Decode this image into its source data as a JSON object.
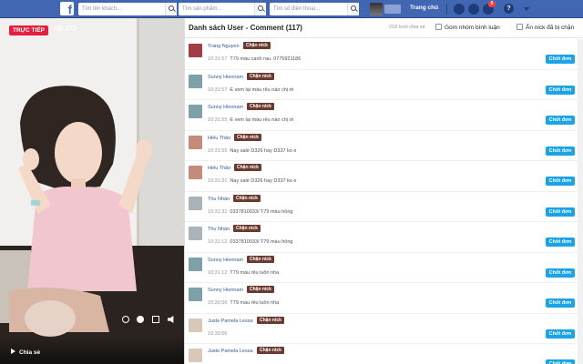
{
  "topbar": {
    "logo": "f",
    "search_name_placeholder": "Tìm tên khách...",
    "search_product_placeholder": "Tìm sản phẩm...",
    "search_phone_placeholder": "Tìm số điện thoại...",
    "home_label": "Trang chủ",
    "notification_count": "5",
    "help_label": "?",
    "colors": {
      "bar": "#4267b2",
      "badge": "#fa3e3e"
    }
  },
  "video": {
    "live_label": "TRỰC TIẾP",
    "viewer_count": "173",
    "share_label": "Chia sẻ"
  },
  "panel": {
    "title": "Danh sách User - Comment (117)",
    "stat": "218 lượt chia sẻ",
    "group_label": "Gom nhóm bình luận",
    "hide_blocked_label": "Ẩn nick đã bị chặn",
    "block_label": "Chặn nick",
    "order_label": "Chốt đơn",
    "comments": [
      {
        "name": "Trang Nguyen",
        "time": "10:31:57",
        "text": "T79 màu canh rau. 0775921186",
        "avatar": "#a23c45"
      },
      {
        "name": "Sunny Hiennam",
        "time": "10:31:57",
        "text": "E xem lại màu rêu nào chị ơi",
        "avatar": "#7ea0a8"
      },
      {
        "name": "Sunny Hiennam",
        "time": "10:31:55",
        "text": "E xem lại màu rêu nào chị ơi",
        "avatar": "#7ea0a8"
      },
      {
        "name": "Hiếu Thảo",
        "time": "10:31:55",
        "text": "Nay sale D326 hay D337 ko e",
        "avatar": "#c48b7a"
      },
      {
        "name": "Hiếu Thảo",
        "time": "10:31:31",
        "text": "Nay sale D326 hay D337 ko e",
        "avatar": "#c48b7a"
      },
      {
        "name": "Thu Nhàn",
        "time": "10:31:31",
        "text": "0337810033/ T79 màu hồng",
        "avatar": "#a9b3b8"
      },
      {
        "name": "Thu Nhàn",
        "time": "10:31:12",
        "text": "0337810033/ T79 màu hồng",
        "avatar": "#a9b3b8"
      },
      {
        "name": "Sunny Hiennam",
        "time": "10:31:12",
        "text": "T79 màu rêu luôn nha",
        "avatar": "#7ea0a8"
      },
      {
        "name": "Sunny Hiennam",
        "time": "10:30:56",
        "text": "T79 màu rêu luôn nha",
        "avatar": "#7ea0a8"
      },
      {
        "name": "Juste Pamela Lessa",
        "time": "10:30:56",
        "text": "",
        "avatar": "#d9c7b8"
      },
      {
        "name": "Juste Pamela Lessa",
        "time": "",
        "text": "",
        "avatar": "#d9c7b8"
      }
    ],
    "colors": {
      "block": "#6b3a2f",
      "order": "#1aa3e8",
      "name": "#385898"
    }
  }
}
